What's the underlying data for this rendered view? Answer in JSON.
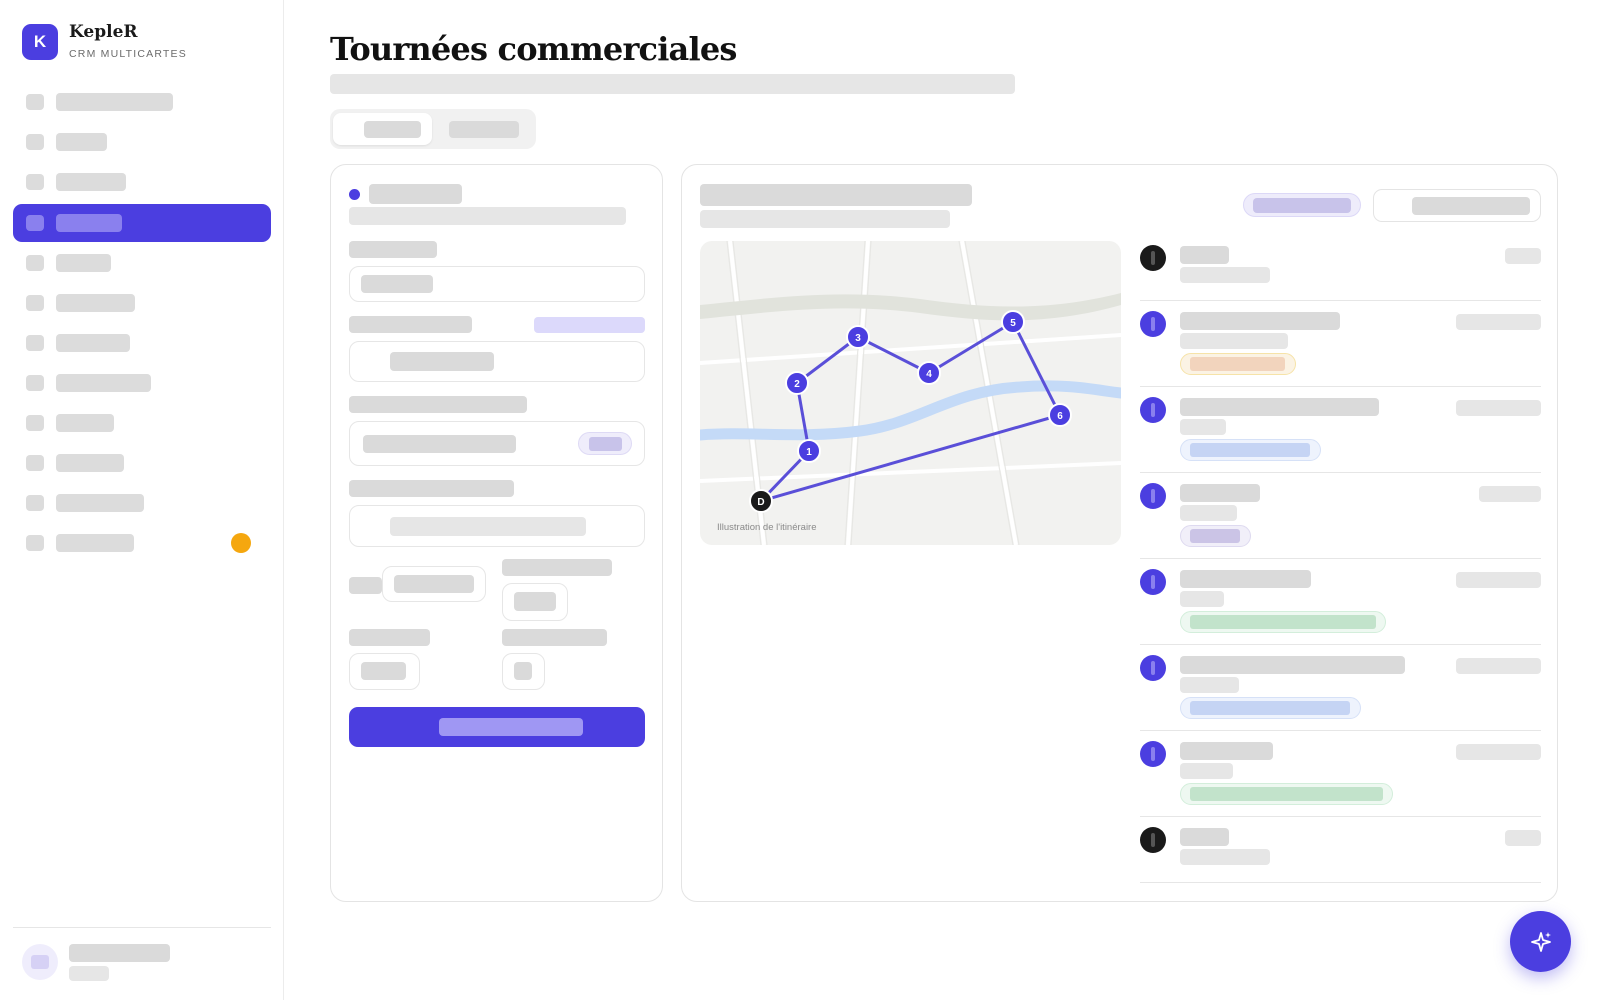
{
  "app": {
    "name": "KepleR",
    "subtitle": "CRM MULTICARTES",
    "logo_letter": "K",
    "accent": "#4b3ee0"
  },
  "page": {
    "title": "Tournées commerciales"
  },
  "map": {
    "caption": "Illustration de l'itinéraire",
    "start_label": "D",
    "stop_labels": [
      "1",
      "2",
      "3",
      "4",
      "5",
      "6"
    ]
  },
  "colors": {
    "accent": "#4b3ee0",
    "badge": "#f5a70f",
    "tag_orange": "#f6dcc4",
    "tag_blue": "#c9d6f5",
    "tag_purple": "#d2cdea",
    "tag_green": "#c6e6cf"
  },
  "icons": {
    "fab": "sparkle-icon"
  }
}
